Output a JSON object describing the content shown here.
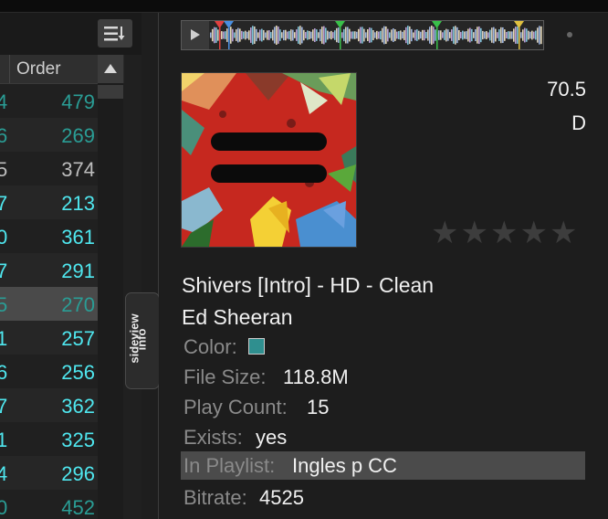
{
  "list": {
    "order_header": "Order",
    "rows": [
      {
        "left": "4",
        "order": "479",
        "color": "#2a9d95",
        "highlight": false
      },
      {
        "left": "6",
        "order": "269",
        "color": "#2a9d95",
        "highlight": false
      },
      {
        "left": "5",
        "order": "374",
        "color": "#bdbdbd",
        "highlight": false
      },
      {
        "left": "7",
        "order": "213",
        "color": "#4fe7ef",
        "highlight": false
      },
      {
        "left": "0",
        "order": "361",
        "color": "#4fe7ef",
        "highlight": false
      },
      {
        "left": "7",
        "order": "291",
        "color": "#4fe7ef",
        "highlight": false
      },
      {
        "left": "5",
        "order": "270",
        "color": "#2a9d95",
        "highlight": true
      },
      {
        "left": "1",
        "order": "257",
        "color": "#4fe7ef",
        "highlight": false
      },
      {
        "left": "6",
        "order": "256",
        "color": "#4fe7ef",
        "highlight": false
      },
      {
        "left": "7",
        "order": "362",
        "color": "#4fe7ef",
        "highlight": false
      },
      {
        "left": "1",
        "order": "325",
        "color": "#4fe7ef",
        "highlight": false
      },
      {
        "left": "4",
        "order": "296",
        "color": "#4fe7ef",
        "highlight": false
      },
      {
        "left": "0",
        "order": "452",
        "color": "#2a9d95",
        "highlight": false
      }
    ]
  },
  "sideview_tab": {
    "line1": "sideview",
    "line2": "info"
  },
  "track": {
    "bpm": "70.5",
    "key": "D",
    "rating": 0,
    "title": "Shivers [Intro] - HD - Clean",
    "artist": "Ed Sheeran"
  },
  "fields": {
    "color": {
      "label": "Color:",
      "value": "#2f8f8f"
    },
    "file_size": {
      "label": "File Size:",
      "value": "118.8M"
    },
    "play_count": {
      "label": "Play Count:",
      "value": "15"
    },
    "exists": {
      "label": "Exists:",
      "value": "yes"
    },
    "in_playlist": {
      "label": "In Playlist:",
      "value": "Ingles p CC"
    },
    "bitrate": {
      "label": "Bitrate:",
      "value": "4525"
    }
  },
  "icons": {
    "menu": "list-menu-icon",
    "sort": "sort-up-icon",
    "play": "play-icon",
    "star": "star-icon"
  }
}
